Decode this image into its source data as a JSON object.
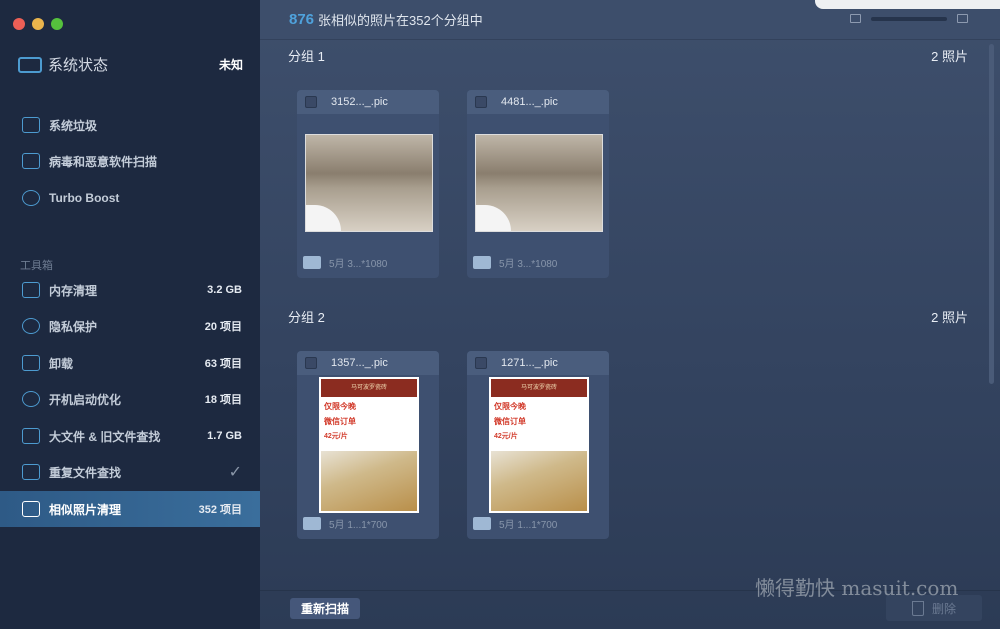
{
  "sidebar": {
    "status": {
      "title": "系统状态",
      "value": "未知"
    },
    "top_items": [
      {
        "label": "系统垃圾"
      },
      {
        "label": "病毒和恶意软件扫描"
      },
      {
        "label": "Turbo Boost"
      }
    ],
    "section": "工具箱",
    "tools": [
      {
        "label": "内存清理",
        "value": "3.2 GB"
      },
      {
        "label": "隐私保护",
        "value": "20 项目"
      },
      {
        "label": "卸载",
        "value": "63 项目"
      },
      {
        "label": "开机启动优化",
        "value": "18 项目"
      },
      {
        "label": "大文件 & 旧文件查找",
        "value": "1.7 GB"
      },
      {
        "label": "重复文件查找",
        "value": "✓"
      },
      {
        "label": "相似照片清理",
        "value": "352 项目"
      }
    ]
  },
  "header": {
    "count": "876",
    "text": "张相似的照片在352个分组中"
  },
  "groups": [
    {
      "title": "分组 1",
      "count": "2 照片",
      "items": [
        {
          "name": "3152..._.pic",
          "meta": "5月 3...*1080"
        },
        {
          "name": "4481..._.pic",
          "meta": "5月 3...*1080"
        }
      ]
    },
    {
      "title": "分组 2",
      "count": "2 照片",
      "items": [
        {
          "name": "1357..._.pic",
          "meta": "5月 1...1*700"
        },
        {
          "name": "1271..._.pic",
          "meta": "5月 1...1*700"
        }
      ]
    }
  ],
  "poster": {
    "brand": "马可波罗瓷砖",
    "line1": "仅限今晚",
    "line2": "微信订单",
    "price": "42元/片"
  },
  "footer": {
    "rescan": "重新扫描",
    "delete": "删除"
  },
  "watermark": "懒得勤快 masuit.com"
}
